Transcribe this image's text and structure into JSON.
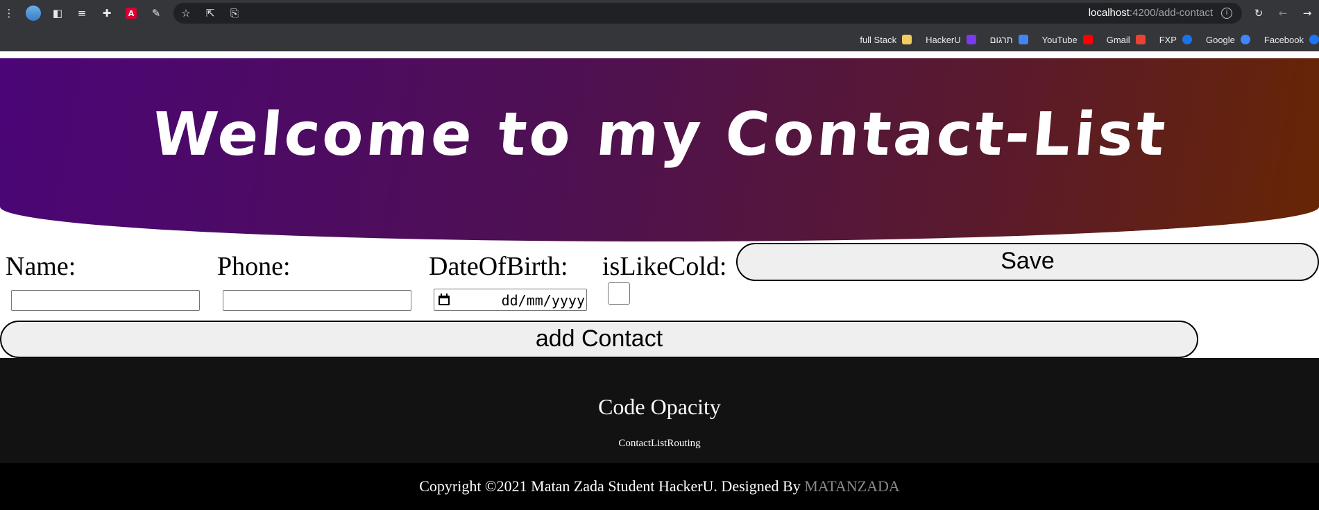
{
  "browser": {
    "url_host": "localhost",
    "url_path": ":4200/add-contact",
    "bookmarks": [
      {
        "label": "full Stack",
        "icon": "folder-icon",
        "color": "#f2cc60"
      },
      {
        "label": "HackerU",
        "icon": "hackeru-icon",
        "color": "#7c3aed"
      },
      {
        "label": "תרגום",
        "icon": "translate-icon",
        "color": "#4285f4"
      },
      {
        "label": "YouTube",
        "icon": "youtube-icon",
        "color": "#ff0000"
      },
      {
        "label": "Gmail",
        "icon": "gmail-icon",
        "color": "#ea4335"
      },
      {
        "label": "FXP",
        "icon": "fxp-icon",
        "color": "#1a73e8"
      },
      {
        "label": "Google",
        "icon": "google-icon",
        "color": "#4285f4"
      },
      {
        "label": "Facebook",
        "icon": "facebook-icon",
        "color": "#1877f2"
      }
    ]
  },
  "hero": {
    "title": "Welcome to my Contact-List"
  },
  "form": {
    "name_label": "Name:",
    "phone_label": "Phone:",
    "dob_label": "DateOfBirth:",
    "cold_label": "isLikeCold:",
    "name_value": "",
    "phone_value": "",
    "date_placeholder": "dd/mm/yyyy",
    "is_like_cold_checked": false,
    "save_label": "Save",
    "add_label": "add Contact"
  },
  "footer": {
    "title": "Code Opacity",
    "subtitle": "ContactListRouting",
    "copyright": "Copyright ©2021 Matan Zada Student HackerU. Designed By",
    "designer": "MATANZADA"
  },
  "colors": {
    "hero_start": "#4b0577",
    "hero_end": "#672604",
    "footer_top": "#121212",
    "footer_bottom": "#000000"
  }
}
